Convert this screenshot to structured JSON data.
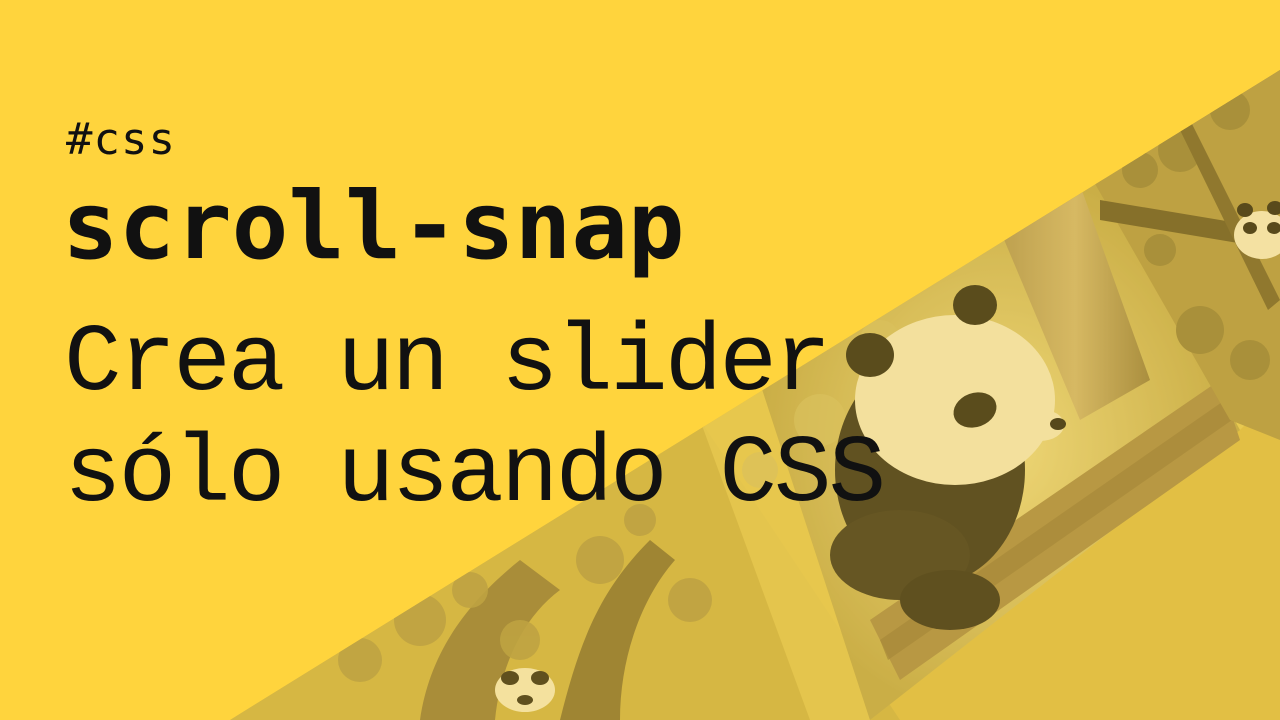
{
  "tag": "#css",
  "title": "scroll-snap",
  "subtitle_line1": "Crea un slider",
  "subtitle_line2": "sólo usando CSS",
  "colors": {
    "background": "#FFD43D",
    "text": "#111111",
    "strip_tint": "#D9B43A"
  },
  "images": [
    "panda-climbing-icon",
    "panda-resting-icon",
    "panda-in-tree-icon"
  ]
}
